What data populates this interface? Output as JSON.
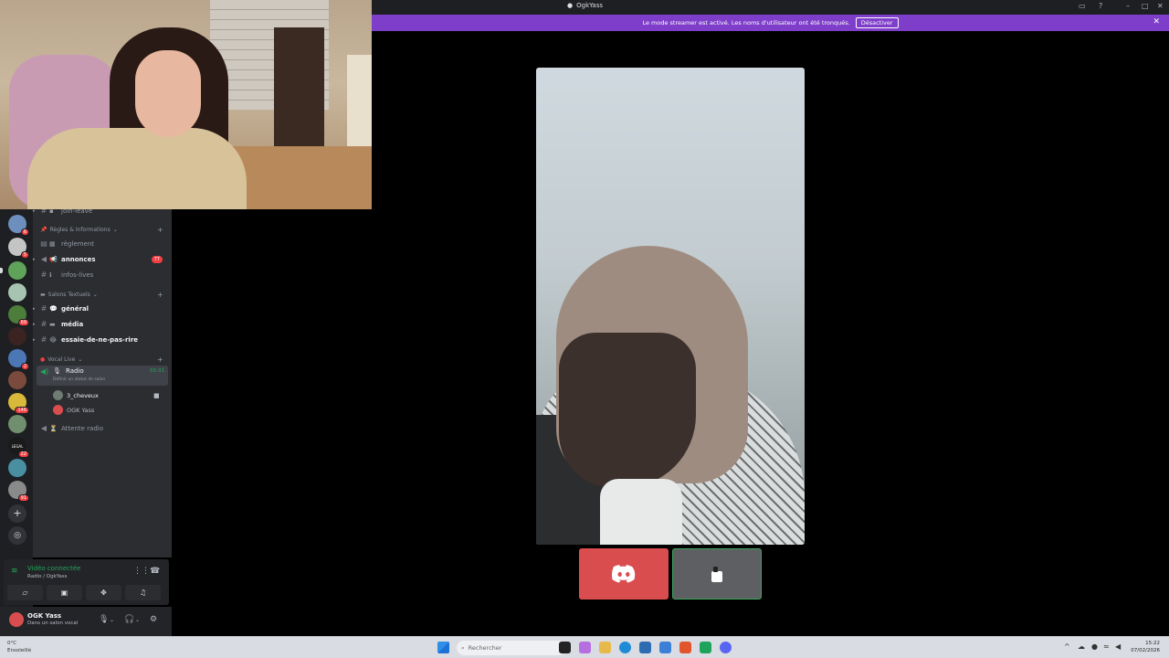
{
  "window": {
    "title": "OgkYass",
    "streamer_banner": "Le mode streamer est activé. Les noms d'utilisateur ont été tronqués.",
    "disable_button": "Désactiver"
  },
  "servers": [
    {
      "color": "#6d8fbd",
      "badge": "6"
    },
    {
      "color": "#c4c4c4",
      "badge": "5"
    },
    {
      "color": "#5fa35a",
      "badge": ""
    },
    {
      "color": "#a7c4b2",
      "badge": ""
    },
    {
      "color": "#4c7d3a",
      "badge": "69"
    },
    {
      "color": "#3a2320",
      "badge": ""
    },
    {
      "color": "#4c77b5",
      "badge": "2"
    },
    {
      "color": "#7a4b3c",
      "badge": ""
    },
    {
      "color": "#d9b93a",
      "badge": "146"
    },
    {
      "color": "#6f8f6f",
      "badge": ""
    },
    {
      "color": "#1a1a1a",
      "badge": "22",
      "text": "LEGAL"
    },
    {
      "color": "#4a8ea1",
      "badge": ""
    },
    {
      "color": "#8a8a8a",
      "badge": "91"
    }
  ],
  "channel_list": {
    "partial_top": "join-leave",
    "categories": {
      "rules": "Règles & Informations",
      "text": "Salons Textuels",
      "voice": "Vocal Live"
    },
    "channels": {
      "reglement": "règlement",
      "annonces": "annonces",
      "annonces_mentions": "77",
      "infos_lives": "infos-lives",
      "general": "général",
      "media": "média",
      "essaie": "essaie-de-ne-pas-rire",
      "radio": "Radio",
      "radio_timer": "55:31",
      "radio_status": "Définir un statut de salon",
      "attente_radio": "Attente radio"
    },
    "voice_users": [
      "3_cheveux",
      "OGK Yass"
    ]
  },
  "voice_connected": {
    "status": "Vidéo connectée",
    "location": "Radio / OgkYass"
  },
  "user_panel": {
    "username": "OGK Yass",
    "status": "Dans un salon vocal"
  },
  "taskbar": {
    "weather_temp": "0°C",
    "weather_desc": "Ensoleillé",
    "search_placeholder": "Rechercher",
    "time": "15:22",
    "date": "07/02/2026"
  },
  "colors": {
    "banner": "#7e3ec9",
    "voice_green": "#23a55a",
    "discord_red": "#da4d4f",
    "mention_red": "#f23f43"
  }
}
